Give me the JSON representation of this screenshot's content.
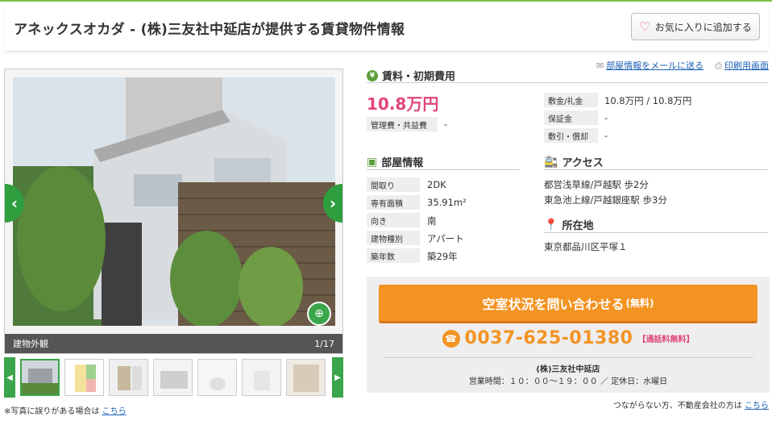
{
  "header": {
    "title": "アネックスオカダ - (株)三友社中延店が提供する賃貸物件情報",
    "favorite_button": "お気に入りに追加する"
  },
  "gallery": {
    "caption": "建物外観",
    "counter": "1/17",
    "thumb_count": 7,
    "note": "※写真に誤りがある場合は",
    "note_link": "こちら"
  },
  "links": {
    "mail": "部屋情報をメールに送る",
    "print": "印刷用画面"
  },
  "rent": {
    "section_title": "賃料・初期費用",
    "price": "10.8万円",
    "fee_label": "管理費・共益費",
    "fee_value": "-",
    "deposit_label": "敷金/礼金",
    "deposit_value": "10.8万円 / 10.8万円",
    "guarantee_label": "保証金",
    "guarantee_value": "-",
    "shikibiki_label": "敷引・償却",
    "shikibiki_value": "-"
  },
  "room": {
    "section_title": "部屋情報",
    "rows": [
      {
        "label": "間取り",
        "value": "2DK"
      },
      {
        "label": "専有面積",
        "value": "35.91m²"
      },
      {
        "label": "向き",
        "value": "南"
      },
      {
        "label": "建物種別",
        "value": "アパート"
      },
      {
        "label": "築年数",
        "value": "築29年"
      }
    ]
  },
  "access": {
    "section_title": "アクセス",
    "lines": [
      "都営浅草線/戸越駅 歩2分",
      "東急池上線/戸越銀座駅 歩3分"
    ]
  },
  "location": {
    "section_title": "所在地",
    "address": "東京都品川区平塚１"
  },
  "contact": {
    "button": "空室状況を問い合わせる",
    "button_suffix": "(無料)",
    "phone": "0037-625-01380",
    "phone_note": "【通話料無料】",
    "shop": "(株)三友社中延店",
    "hours": "営業時間：１０：００～１９：００ ／ 定休日：水曜日"
  },
  "footer": {
    "note": "つながらない方、不動産会社の方は",
    "link": "こちら"
  },
  "colors": {
    "accent_green": "#3aa54a",
    "price_pink": "#e2457a",
    "cta_orange": "#f39322"
  }
}
